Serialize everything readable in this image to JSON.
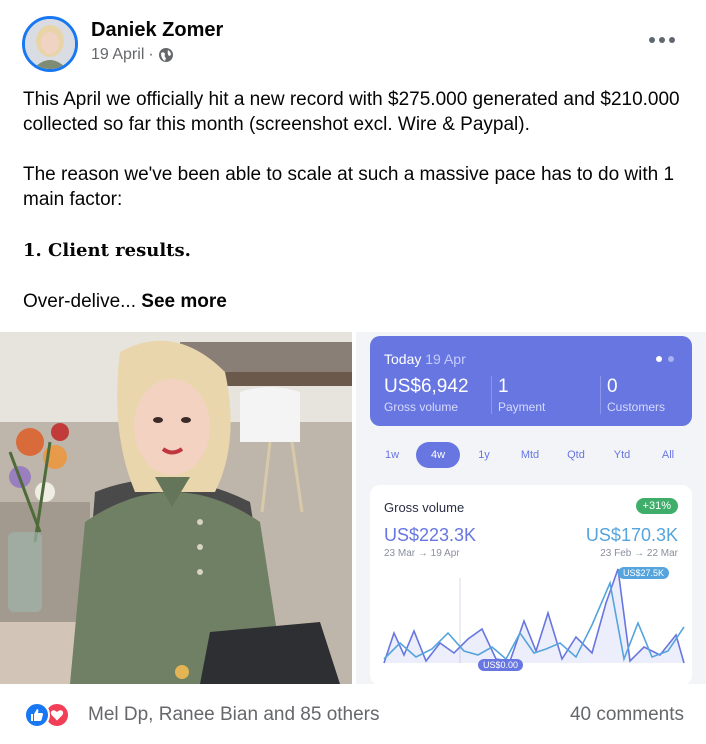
{
  "post": {
    "author": "Daniek Zomer",
    "date": "19 April",
    "separator": "·",
    "privacy_icon": "globe-icon",
    "more_icon": "more-options-icon",
    "text_p1": "This April we officially hit a new record with $275.000 generated and $210.000 collected so far this month (screenshot excl. Wire & Paypal).",
    "text_p2": "The reason we've been able to scale at such a massive pace has to do with 1 main factor:",
    "text_p3": "1. Client results.",
    "text_p4": "Over-delive...",
    "see_more": "See more"
  },
  "stripe": {
    "today_label": "Today",
    "today_date": "19 Apr",
    "stats": [
      {
        "value": "US$6,942",
        "label": "Gross volume"
      },
      {
        "value": "1",
        "label": "Payment"
      },
      {
        "value": "0",
        "label": "Customers"
      }
    ],
    "ranges": [
      "1w",
      "4w",
      "1y",
      "Mtd",
      "Qtd",
      "Ytd",
      "All"
    ],
    "active_range": "4w",
    "gross": {
      "title": "Gross volume",
      "change": "+31%",
      "current_value": "US$223.3K",
      "current_period": "23 Mar → 19 Apr",
      "previous_value": "US$170.3K",
      "previous_period": "23 Feb → 22 Mar",
      "peak_label": "US$27.5K",
      "zero_label": "US$0.00"
    }
  },
  "footer": {
    "reactions": [
      "like-icon",
      "love-icon"
    ],
    "names": "Mel Dp, Ranee Bian and 85 others",
    "comments": "40 comments"
  },
  "colors": {
    "facebook_blue": "#1877f2",
    "stripe_purple": "#6776e0",
    "stripe_blue": "#55a4dd",
    "badge_green": "#3fae6b",
    "meta_gray": "#65676b"
  }
}
